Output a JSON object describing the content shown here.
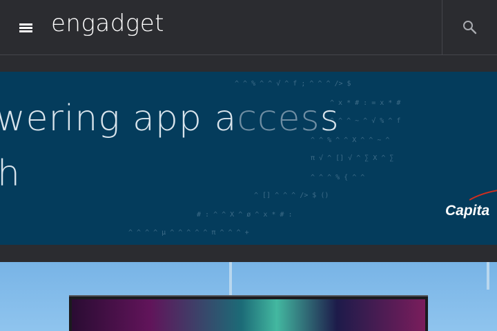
{
  "header": {
    "logo_text": "engadget",
    "menu_icon": "hamburger-menu-icon",
    "search_icon": "search-icon"
  },
  "ad": {
    "headline_line1_main": "wering app a",
    "headline_line1_fade": "cces",
    "headline_line1_end": "s",
    "headline_line2": "h",
    "brand": "Capita",
    "background": "#043c5c"
  },
  "story": {
    "image_subject": "television-display"
  }
}
